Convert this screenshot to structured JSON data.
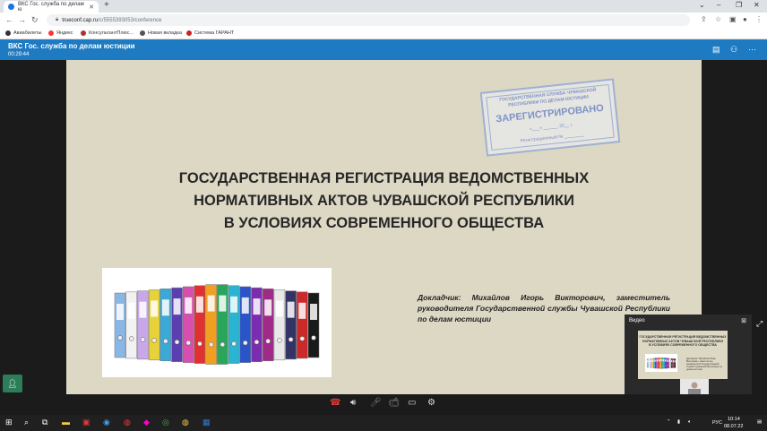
{
  "browser": {
    "tab_title": "ВКС Гос. служба по делам ю",
    "url_host": "trueconf.cap.ru",
    "url_path": "/c/5555393053/conference",
    "bookmarks": [
      "Авиабилеты",
      "Яндекс",
      "КонсультантПлюс...",
      "Новая вкладка",
      "Система ГАРАНТ"
    ]
  },
  "app": {
    "title": "ВКС Гос. служба по делам юстиции",
    "timer": "00:29:44"
  },
  "slide": {
    "stamp_line1": "ГОСУДАРСТВЕННАЯ СЛУЖБА ЧУВАШСКОЙ",
    "stamp_line2": "РЕСПУБЛИКИ ПО ДЕЛАМ ЮСТИЦИИ",
    "stamp_main": "ЗАРЕГИСТРИРОВАНО",
    "stamp_date": "«___» ______ 20__ г.",
    "stamp_regno": "Регистрационный № ________",
    "headline_1": "ГОСУДАРСТВЕННАЯ РЕГИСТРАЦИЯ ВЕДОМСТВЕННЫХ",
    "headline_2": "НОРМАТИВНЫХ АКТОВ ЧУВАШСКОЙ РЕСПУБЛИКИ",
    "headline_3": "В УСЛОВИЯХ СОВРЕМЕННОГО ОБЩЕСТВА",
    "speaker": "Докладчик: Михайлов Игорь Викторович, заместитель руководителя Государственной службы Чувашской Республики по делам юстиции",
    "binder_colors": [
      "#8ab6e6",
      "#f2f2f2",
      "#c8a8e8",
      "#e8d23a",
      "#3aa9d6",
      "#5b3fb0",
      "#d74fae",
      "#e03030",
      "#f0a020",
      "#2aa65a",
      "#29b5d1",
      "#2a55c8",
      "#7b2db0",
      "#a02a8a",
      "#e8e8e8",
      "#333366",
      "#cc2a2a",
      "#1a1a1a"
    ]
  },
  "video": {
    "label": "Видео"
  },
  "taskbar": {
    "lang": "РУС",
    "time": "10:14",
    "date": "08.07.22"
  }
}
